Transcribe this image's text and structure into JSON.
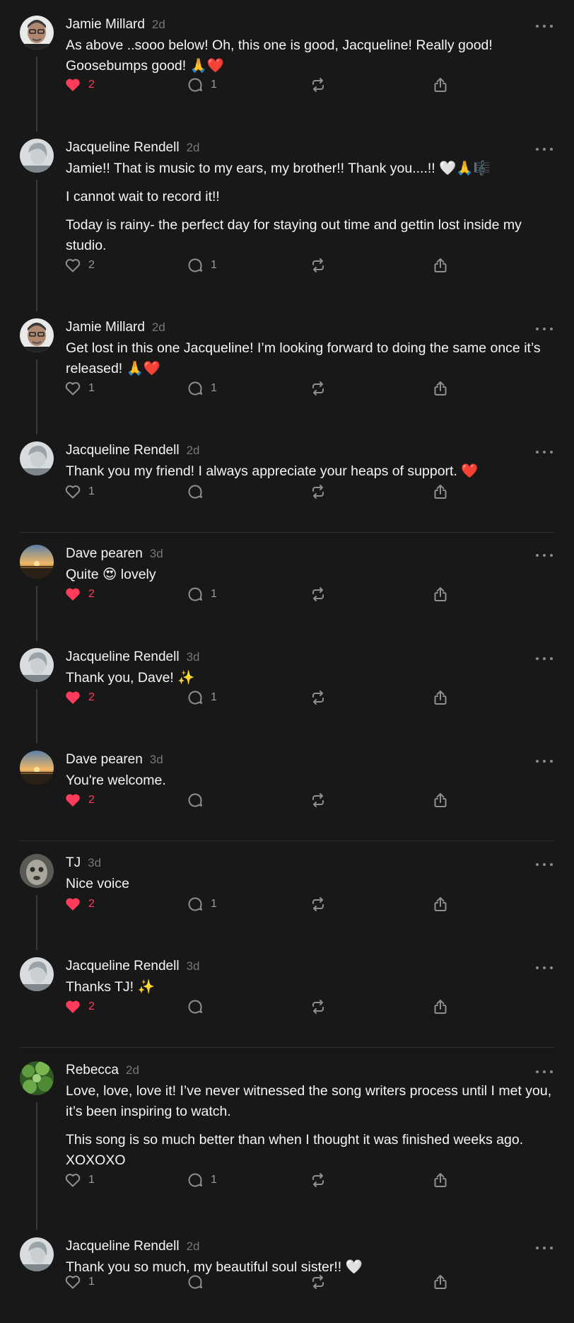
{
  "colors": {
    "background": "#181818",
    "text": "#f3f5f7",
    "muted": "#777777",
    "like_active": "#ff3b5c",
    "thread_line": "#3a3a3a"
  },
  "icons": [
    "heart-icon",
    "comment-icon",
    "repost-icon",
    "share-icon",
    "more-icon"
  ],
  "posts": [
    {
      "author": "Jamie Millard",
      "time": "2d",
      "lines": [
        "As above ..sooo below! Oh, this one is good, Jacqueline! Really good! Goosebumps good! 🙏❤️"
      ],
      "likes": "2",
      "liked": true,
      "replies": "1",
      "avatar": "jamie"
    },
    {
      "author": "Jacqueline Rendell",
      "time": "2d",
      "lines": [
        "Jamie!! That is music to my ears, my brother!! Thank you....!! 🤍🙏🎼",
        "I cannot wait to record it!!",
        "Today is rainy- the perfect day for staying out time and gettin lost inside my studio."
      ],
      "likes": "2",
      "liked": false,
      "replies": "1",
      "avatar": "jacqueline"
    },
    {
      "author": "Jamie Millard",
      "time": "2d",
      "lines": [
        "Get lost in this one Jacqueline! I’m looking forward to doing the same once it’s released! 🙏❤️"
      ],
      "likes": "1",
      "liked": false,
      "replies": "1",
      "avatar": "jamie"
    },
    {
      "author": "Jacqueline Rendell",
      "time": "2d",
      "lines": [
        "Thank you my friend! I always appreciate your heaps of support. ❤️"
      ],
      "likes": "1",
      "liked": false,
      "replies": "",
      "avatar": "jacqueline"
    },
    {
      "author": "Dave pearen",
      "time": "3d",
      "lines": [
        "Quite 😍 lovely"
      ],
      "likes": "2",
      "liked": true,
      "replies": "1",
      "avatar": "dave"
    },
    {
      "author": "Jacqueline Rendell",
      "time": "3d",
      "lines": [
        "Thank you, Dave! ✨"
      ],
      "likes": "2",
      "liked": true,
      "replies": "1",
      "avatar": "jacqueline"
    },
    {
      "author": "Dave pearen",
      "time": "3d",
      "lines": [
        "You're welcome."
      ],
      "likes": "2",
      "liked": true,
      "replies": "",
      "avatar": "dave"
    },
    {
      "author": "TJ",
      "time": "3d",
      "lines": [
        "Nice voice"
      ],
      "likes": "2",
      "liked": true,
      "replies": "1",
      "avatar": "tj"
    },
    {
      "author": "Jacqueline Rendell",
      "time": "3d",
      "lines": [
        "Thanks TJ! ✨"
      ],
      "likes": "2",
      "liked": true,
      "replies": "",
      "avatar": "jacqueline"
    },
    {
      "author": "Rebecca",
      "time": "2d",
      "lines": [
        "Love, love, love it! I’ve never witnessed the song writers process until I met you, it’s been inspiring to watch.",
        "This song is so much better than when I thought it was finished weeks ago. XOXOXO"
      ],
      "likes": "1",
      "liked": false,
      "replies": "1",
      "avatar": "rebecca"
    },
    {
      "author": "Jacqueline Rendell",
      "time": "2d",
      "lines": [
        "Thank you so much, my beautiful soul sister!! 🤍"
      ],
      "likes": "1",
      "liked": false,
      "replies": "",
      "avatar": "jacqueline"
    }
  ]
}
